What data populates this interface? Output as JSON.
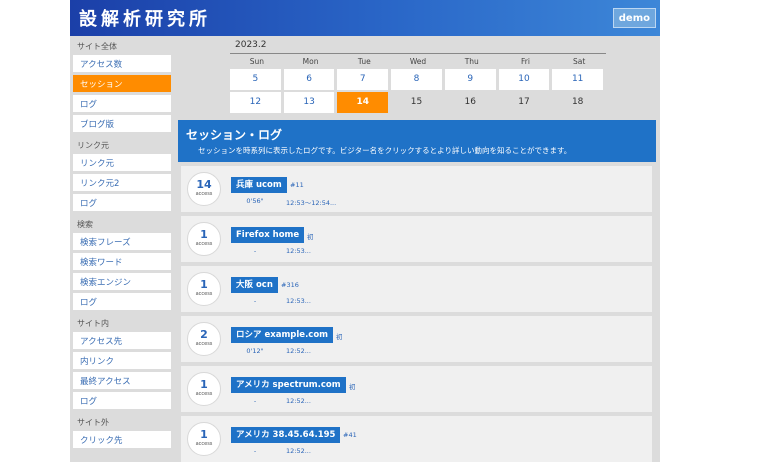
{
  "header": {
    "logo": "設解析研究所",
    "demo_badge": "demo"
  },
  "sidebar": {
    "sections": [
      {
        "heading": "サイト全体",
        "items": [
          {
            "label": "アクセス数",
            "active": false
          },
          {
            "label": "セッション",
            "active": true
          },
          {
            "label": "ログ",
            "active": false
          },
          {
            "label": "ブログ版",
            "active": false
          }
        ]
      },
      {
        "heading": "リンク元",
        "items": [
          {
            "label": "リンク元",
            "active": false
          },
          {
            "label": "リンク元2",
            "active": false
          },
          {
            "label": "ログ",
            "active": false
          }
        ]
      },
      {
        "heading": "検索",
        "items": [
          {
            "label": "検索フレーズ",
            "active": false
          },
          {
            "label": "検索ワード",
            "active": false
          },
          {
            "label": "検索エンジン",
            "active": false
          },
          {
            "label": "ログ",
            "active": false
          }
        ]
      },
      {
        "heading": "サイト内",
        "items": [
          {
            "label": "アクセス先",
            "active": false
          },
          {
            "label": "内リンク",
            "active": false
          },
          {
            "label": "最終アクセス",
            "active": false
          },
          {
            "label": "ログ",
            "active": false
          }
        ]
      },
      {
        "heading": "サイト外",
        "items": [
          {
            "label": "クリック先",
            "active": false
          }
        ]
      }
    ]
  },
  "calendar": {
    "month": "2023.2",
    "weekdays": [
      "Sun",
      "Mon",
      "Tue",
      "Wed",
      "Thu",
      "Fri",
      "Sat"
    ],
    "weeks": [
      [
        {
          "day": "5",
          "state": "normal"
        },
        {
          "day": "6",
          "state": "normal"
        },
        {
          "day": "7",
          "state": "normal"
        },
        {
          "day": "8",
          "state": "normal"
        },
        {
          "day": "9",
          "state": "normal"
        },
        {
          "day": "10",
          "state": "normal"
        },
        {
          "day": "11",
          "state": "normal"
        }
      ],
      [
        {
          "day": "12",
          "state": "normal"
        },
        {
          "day": "13",
          "state": "normal"
        },
        {
          "day": "14",
          "state": "today"
        },
        {
          "day": "15",
          "state": "future"
        },
        {
          "day": "16",
          "state": "future"
        },
        {
          "day": "17",
          "state": "future"
        },
        {
          "day": "18",
          "state": "future"
        }
      ]
    ]
  },
  "log": {
    "title": "セッション・ログ",
    "description": "セッションを時系列に表示したログです。ビジター名をクリックするとより詳しい動向を知ることができます。",
    "access_label": "access",
    "entries": [
      {
        "count": "14",
        "visitor": "兵庫 ucom",
        "visit_no": "#11",
        "duration": "0'56\"",
        "time": "12:53～12:54..."
      },
      {
        "count": "1",
        "visitor": "Firefox home",
        "visit_no": "初",
        "duration": "-",
        "time": "12:53..."
      },
      {
        "count": "1",
        "visitor": "大阪 ocn",
        "visit_no": "#316",
        "duration": "-",
        "time": "12:53..."
      },
      {
        "count": "2",
        "visitor": "ロシア example.com",
        "visit_no": "初",
        "duration": "0'12\"",
        "time": "12:52..."
      },
      {
        "count": "1",
        "visitor": "アメリカ spectrum.com",
        "visit_no": "初",
        "duration": "-",
        "time": "12:52..."
      },
      {
        "count": "1",
        "visitor": "アメリカ 38.45.64.195",
        "visit_no": "#41",
        "duration": "-",
        "time": "12:52..."
      }
    ]
  },
  "colors": {
    "header_blue": "#1f72c7",
    "accent_orange": "#ff8c00",
    "link_blue": "#2a65b8"
  }
}
